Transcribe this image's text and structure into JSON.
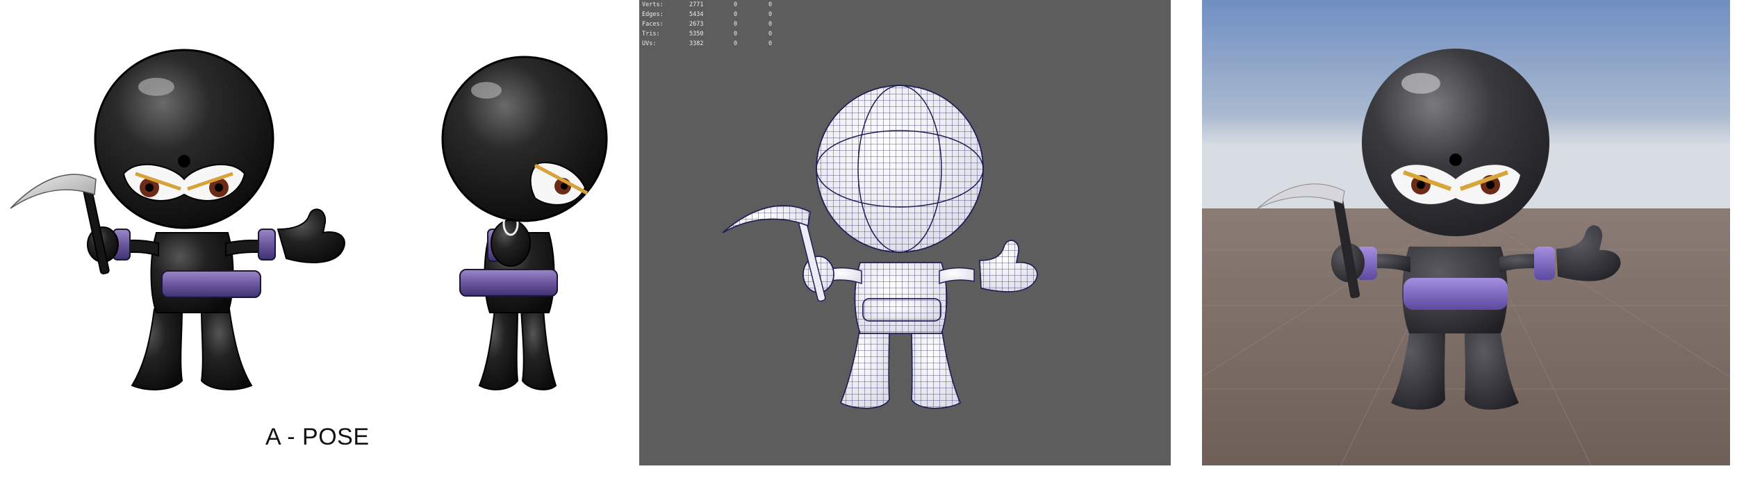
{
  "concept": {
    "caption": "A - POSE"
  },
  "viewport": {
    "stats": [
      {
        "label": "Verts:",
        "value": "2771",
        "col2": "0",
        "col3": "0"
      },
      {
        "label": "Edges:",
        "value": "5434",
        "col2": "0",
        "col3": "0"
      },
      {
        "label": "Faces:",
        "value": "2673",
        "col2": "0",
        "col3": "0"
      },
      {
        "label": "Tris:",
        "value": "5350",
        "col2": "0",
        "col3": "0"
      },
      {
        "label": "UVs:",
        "value": "3382",
        "col2": "0",
        "col3": "0"
      }
    ]
  }
}
